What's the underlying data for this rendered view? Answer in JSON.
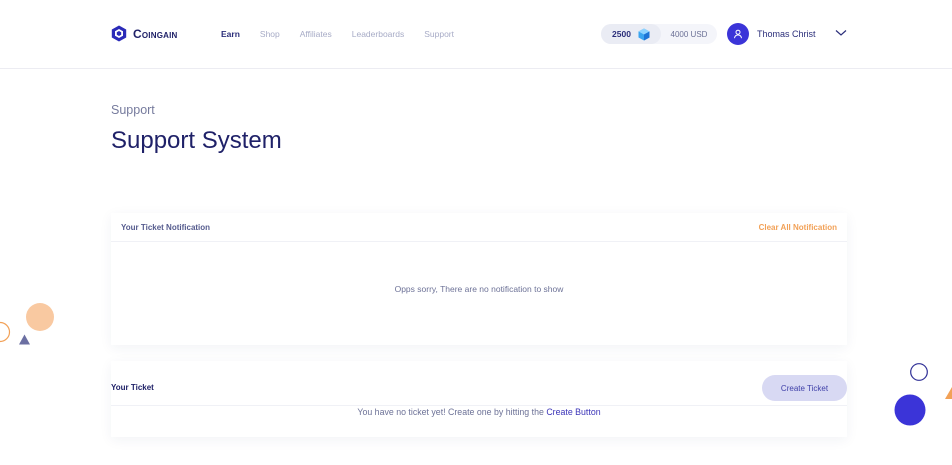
{
  "brand": {
    "name": "Coingain"
  },
  "nav": {
    "items": [
      {
        "label": "Earn",
        "active": true
      },
      {
        "label": "Shop",
        "active": false
      },
      {
        "label": "Affiliates",
        "active": false
      },
      {
        "label": "Leaderboards",
        "active": false
      },
      {
        "label": "Support",
        "active": false
      }
    ]
  },
  "wallet": {
    "coins": "2500",
    "usd": "4000 USD",
    "coin_icon": "gem-icon"
  },
  "user": {
    "name": "Thomas Christ",
    "avatar_icon": "user-icon"
  },
  "page": {
    "breadcrumb": "Support",
    "title": "Support System"
  },
  "notifications": {
    "title": "Your Ticket Notification",
    "clear_label": "Clear All Notification",
    "empty_text": "Opps sorry, There are no notification to show"
  },
  "tickets": {
    "title": "Your Ticket",
    "create_label": "Create Ticket",
    "empty_text": "You have no ticket yet! Create one by hitting the ",
    "empty_highlight": "Create Button"
  },
  "colors": {
    "accent": "#3b34d8",
    "title": "#1f2168",
    "orange": "#f2a157",
    "peach": "#f9c9a1",
    "muted": "#a7abc6"
  }
}
